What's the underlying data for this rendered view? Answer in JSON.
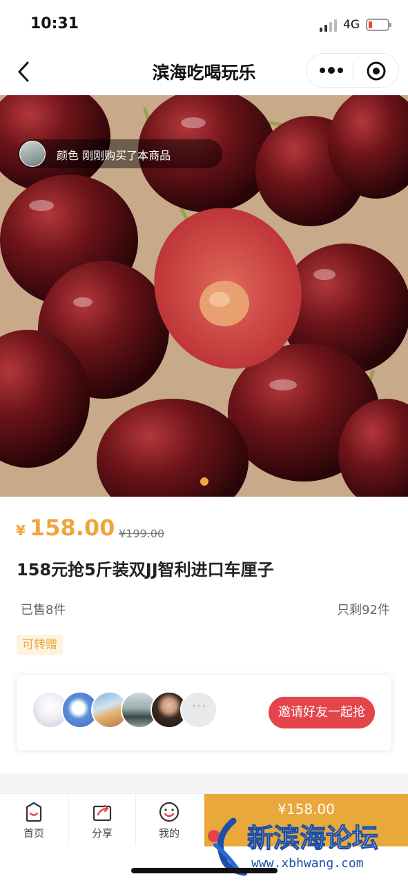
{
  "status": {
    "time": "10:31",
    "network": "4G"
  },
  "nav": {
    "title": "滨海吃喝玩乐"
  },
  "hero": {
    "toast": "颜色 刚刚购买了本商品",
    "slide_count": 1,
    "active_slide": 1
  },
  "product": {
    "currency": "¥",
    "price": "158.00",
    "original_price": "¥199.00",
    "title": "158元抢5斤装双JJ智利进口车厘子",
    "sold": "已售8件",
    "remaining": "只剩92件",
    "tag": "可转赠"
  },
  "friends": {
    "more_label": "···",
    "invite_label": "邀请好友一起抢"
  },
  "bottom_bar": {
    "tabs": [
      {
        "label": "首页",
        "icon": "home-icon"
      },
      {
        "label": "分享",
        "icon": "share-icon"
      },
      {
        "label": "我的",
        "icon": "profile-icon"
      }
    ],
    "buy_price": "¥158.00"
  },
  "watermark": {
    "title": "新滨海论坛",
    "url": "www.xbhwang.com"
  },
  "colors": {
    "accent": "#f0a53a",
    "invite": "#e4454a",
    "buy": "#e9a83a"
  }
}
